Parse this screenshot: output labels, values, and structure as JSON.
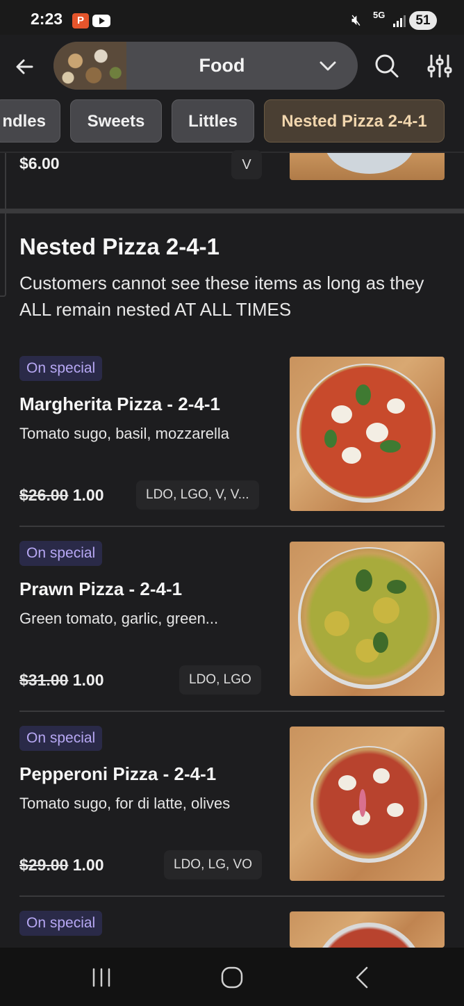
{
  "status_bar": {
    "time": "2:23",
    "battery": "51",
    "network": "5G"
  },
  "top_bar": {
    "category": "Food"
  },
  "chips": [
    "ndles",
    "Sweets",
    "Littles",
    "Nested Pizza 2-4-1"
  ],
  "previous_item": {
    "price": "$6.00",
    "tags": "V"
  },
  "section": {
    "title": "Nested Pizza 2-4-1",
    "description": "Customers cannot see these items as long as they ALL remain nested AT ALL TIMES"
  },
  "items": [
    {
      "badge": "On special",
      "title": "Margherita Pizza - 2-4-1",
      "description": "Tomato sugo, basil, mozzarella",
      "old_price": "$26.00",
      "price": "1.00",
      "tags": "LDO, LGO, V, V..."
    },
    {
      "badge": "On special",
      "title": "Prawn Pizza - 2-4-1",
      "description": "Green tomato, garlic, green...",
      "old_price": "$31.00",
      "price": "1.00",
      "tags": "LDO, LGO"
    },
    {
      "badge": "On special",
      "title": "Pepperoni Pizza - 2-4-1",
      "description": "Tomato sugo, for di latte, olives",
      "old_price": "$29.00",
      "price": "1.00",
      "tags": "LDO, LG, VO"
    },
    {
      "badge": "On special"
    }
  ],
  "colors": {
    "background": "#1d1d1f",
    "active_chip_text": "#f1d6ae",
    "badge_text": "#b7a8f4"
  },
  "icons": [
    "back-arrow-icon",
    "chevron-down-icon",
    "search-icon",
    "filter-sliders-icon",
    "recent-apps-icon",
    "home-icon",
    "nav-back-icon"
  ]
}
